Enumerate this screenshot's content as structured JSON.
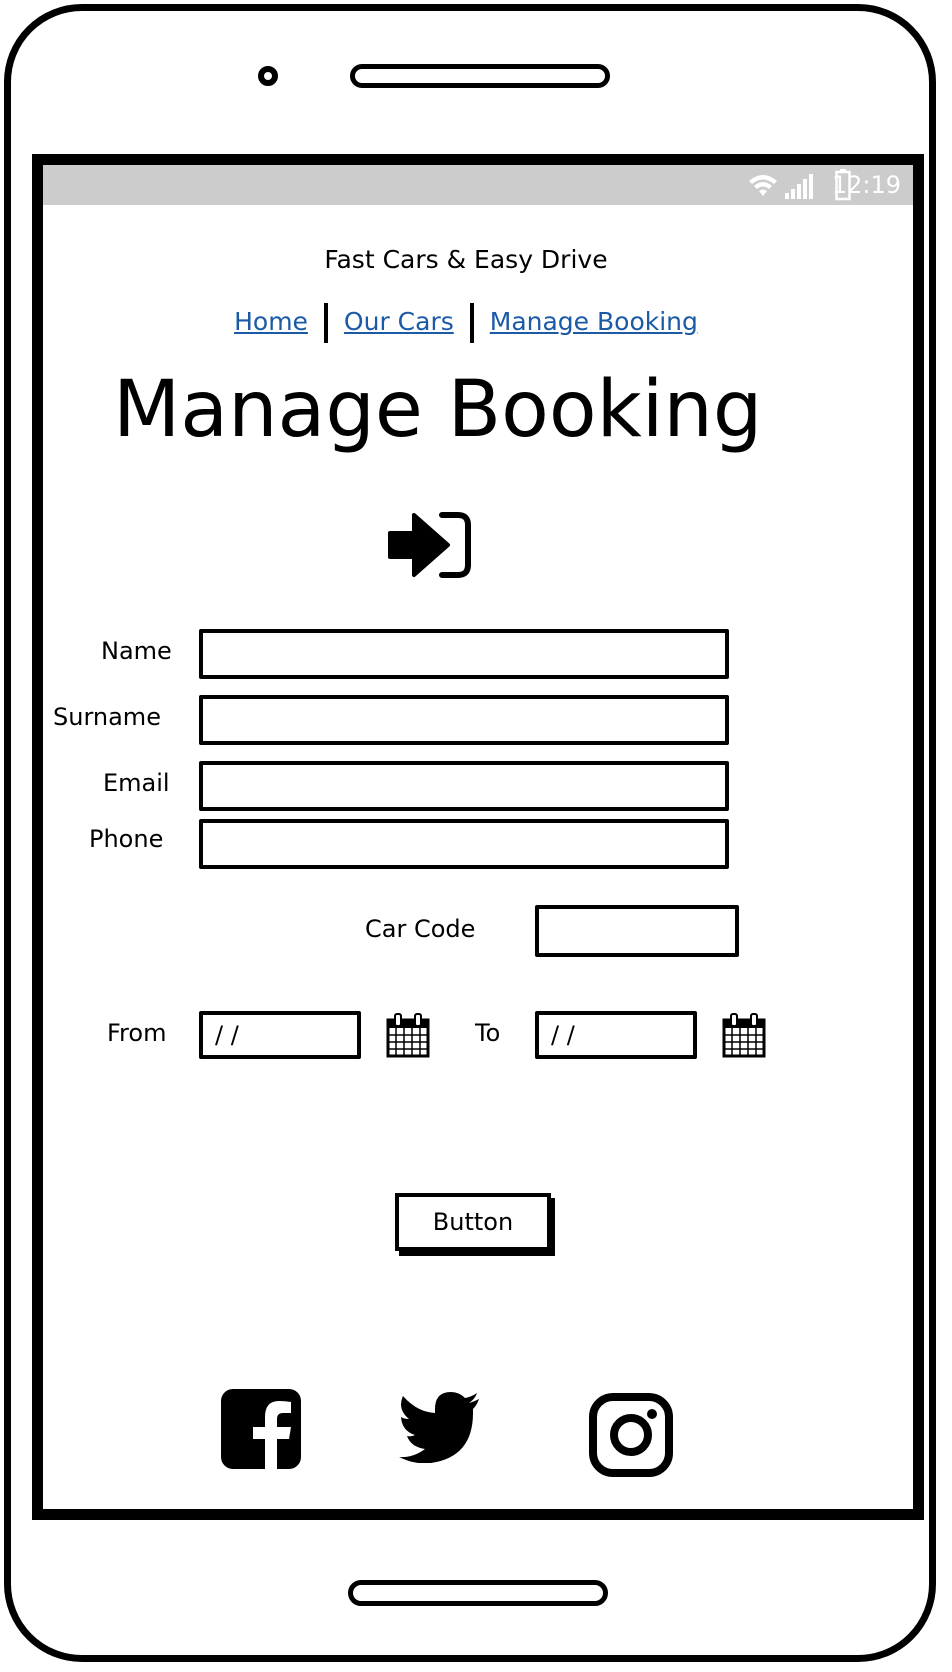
{
  "status_bar": {
    "time": "12:19"
  },
  "app_title": "Fast Cars & Easy Drive",
  "nav": {
    "items": [
      "Home",
      "Our Cars",
      "Manage Booking"
    ]
  },
  "page": {
    "heading": "Manage Booking"
  },
  "form": {
    "name_label": "Name",
    "surname_label": "Surname",
    "email_label": "Email",
    "phone_label": "Phone",
    "car_code_label": "Car Code",
    "from_label": "From",
    "to_label": "To",
    "from_value": "/ /",
    "to_value": "/ /",
    "submit_label": "Button"
  },
  "icons": {
    "login": "sign-in-icon",
    "calendar": "calendar-icon",
    "facebook": "facebook-icon",
    "twitter": "twitter-icon",
    "instagram": "instagram-icon"
  }
}
